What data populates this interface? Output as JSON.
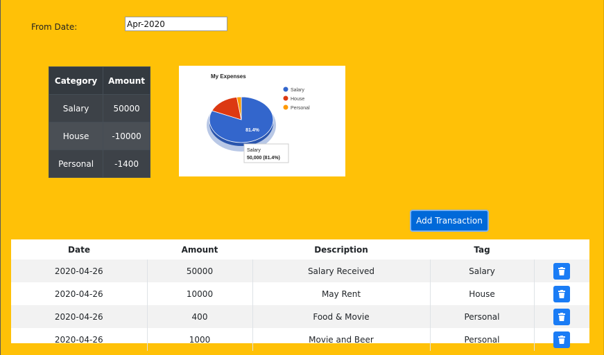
{
  "filter": {
    "label": "From Date:",
    "value": "Apr-2020"
  },
  "summary": {
    "headers": [
      "Category",
      "Amount"
    ],
    "rows": [
      {
        "category": "Salary",
        "amount": "50000"
      },
      {
        "category": "House",
        "amount": "-10000"
      },
      {
        "category": "Personal",
        "amount": "-1400"
      }
    ]
  },
  "chart_data": {
    "type": "pie",
    "title": "My Expenses",
    "categories": [
      "Salary",
      "House",
      "Personal"
    ],
    "values": [
      50000,
      10000,
      1400
    ],
    "colors": [
      "#3366cc",
      "#dc3912",
      "#ff9900"
    ],
    "slice_label": "81.4%",
    "legend_position": "right",
    "tooltip": {
      "name": "Salary",
      "value": "50,000 (81.4%)"
    }
  },
  "actions": {
    "add_label": "Add Transaction"
  },
  "transactions": {
    "headers": [
      "Date",
      "Amount",
      "Description",
      "Tag",
      ""
    ],
    "rows": [
      {
        "date": "2020-04-26",
        "amount": "50000",
        "description": "Salary Received",
        "tag": "Salary"
      },
      {
        "date": "2020-04-26",
        "amount": "10000",
        "description": "May Rent",
        "tag": "House"
      },
      {
        "date": "2020-04-26",
        "amount": "400",
        "description": "Food & Movie",
        "tag": "Personal"
      },
      {
        "date": "2020-04-26",
        "amount": "1000",
        "description": "Movie and Beer",
        "tag": "Personal"
      }
    ],
    "delete_icon": "trash-icon"
  }
}
